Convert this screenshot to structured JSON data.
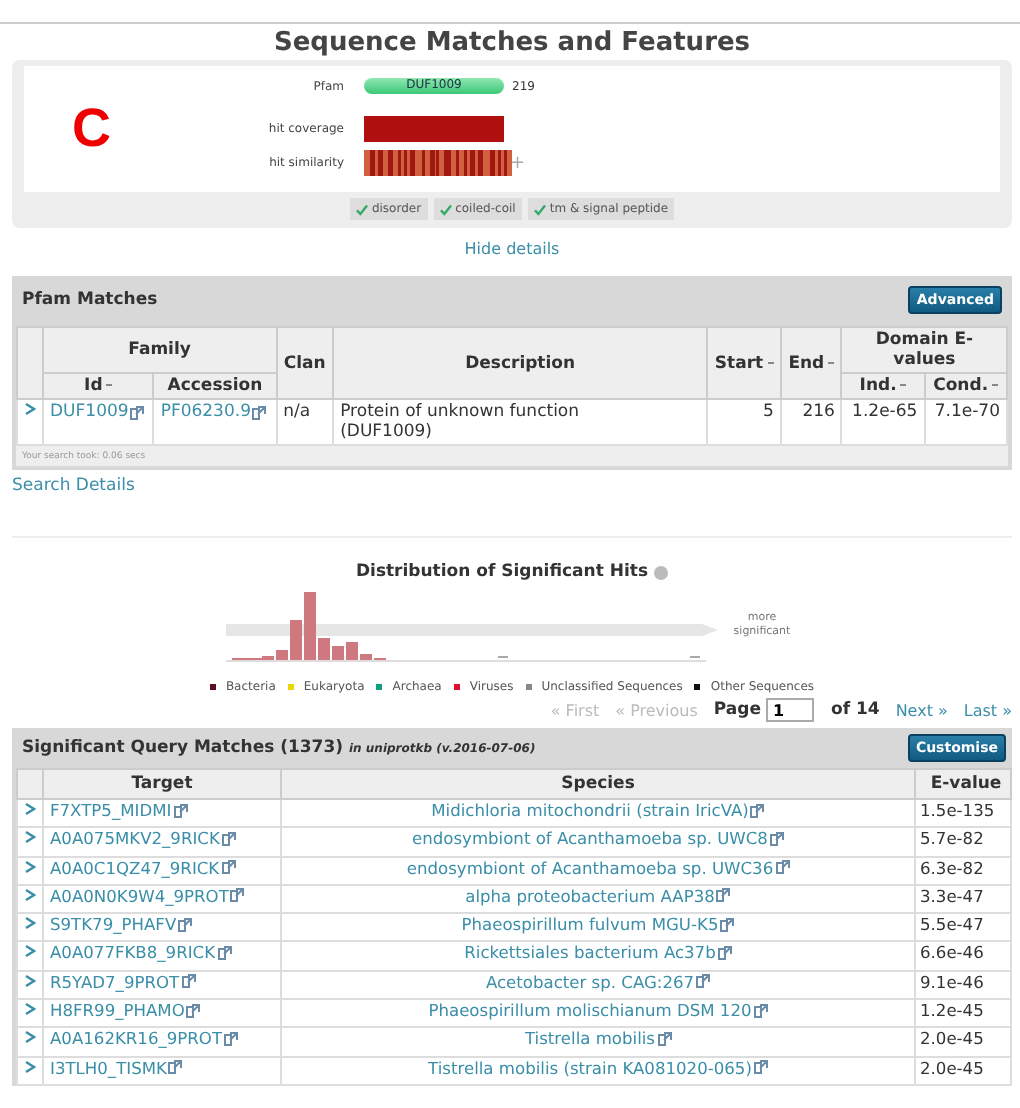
{
  "features": {
    "title": "Sequence Matches and Features",
    "panel_letter": "C",
    "pfam_label": "Pfam",
    "domain": "DUF1009",
    "length": "219",
    "coverage_label": "hit coverage",
    "similarity_label": "hit similarity",
    "expand": "+",
    "toggles": [
      {
        "label": "disorder",
        "checked": true
      },
      {
        "label": "coiled-coil",
        "checked": true
      },
      {
        "label": "tm & signal peptide",
        "checked": true
      }
    ],
    "hide_link": "Hide details"
  },
  "pfam_matches": {
    "title": "Pfam Matches",
    "button": "Advanced",
    "group_family": "Family",
    "group_evalues": "Domain E-values",
    "columns": [
      "Id",
      "Accession",
      "Clan",
      "Description",
      "Start",
      "End",
      "Ind.",
      "Cond."
    ],
    "rows": [
      {
        "id": "DUF1009",
        "accession": "PF06230.9",
        "clan": "n/a",
        "description": "Protein of unknown function (DUF1009)",
        "start": "5",
        "end": "216",
        "ind": "1.2e-65",
        "cond": "7.1e-70"
      }
    ],
    "footer": "Your search took: 0.06 secs",
    "search_details": "Search Details"
  },
  "distribution": {
    "title": "Distribution of Significant Hits",
    "arrow_label": "more significant",
    "legend": [
      {
        "label": "Bacteria",
        "color": "#5a1020"
      },
      {
        "label": "Eukaryota",
        "color": "#e8d800"
      },
      {
        "label": "Archaea",
        "color": "#10a080"
      },
      {
        "label": "Viruses",
        "color": "#e01030"
      },
      {
        "label": "Unclassified Sequences",
        "color": "#888888"
      },
      {
        "label": "Other Sequences",
        "color": "#111111"
      }
    ]
  },
  "pager": {
    "before": [
      {
        "label": "« First",
        "disabled": true
      },
      {
        "label": "« Previous",
        "disabled": true
      }
    ],
    "page_label": "Page",
    "page_value": "1",
    "total": "of 14",
    "after": [
      {
        "label": "Next »",
        "disabled": false
      },
      {
        "label": "Last »",
        "disabled": false
      }
    ]
  },
  "query_matches": {
    "title": "Significant Query Matches (1373)",
    "subtitle": "in uniprotkb (v.2016-07-06)",
    "button": "Customise",
    "columns": [
      "Target",
      "Species",
      "E-value"
    ],
    "rows": [
      {
        "target": "F7XTP5_MIDMI",
        "species": "Midichloria mitochondrii (strain IricVA)",
        "evalue": "1.5e-135"
      },
      {
        "target": "A0A075MKV2_9RICK",
        "species": "endosymbiont of Acanthamoeba sp. UWC8",
        "evalue": "5.7e-82"
      },
      {
        "target": "A0A0C1QZ47_9RICK",
        "species": "endosymbiont of Acanthamoeba sp. UWC36",
        "evalue": "6.3e-82"
      },
      {
        "target": "A0A0N0K9W4_9PROT",
        "species": "alpha proteobacterium AAP38",
        "evalue": "3.3e-47"
      },
      {
        "target": "S9TK79_PHAFV",
        "species": "Phaeospirillum fulvum MGU-K5",
        "evalue": "5.5e-47"
      },
      {
        "target": "A0A077FKB8_9RICK",
        "species": "Rickettsiales bacterium Ac37b",
        "evalue": "6.6e-46"
      },
      {
        "target": "R5YAD7_9PROT",
        "species": "Acetobacter sp. CAG:267",
        "evalue": "9.1e-46"
      },
      {
        "target": "H8FR99_PHAMO",
        "species": "Phaeospirillum molischianum DSM 120",
        "evalue": "1.2e-45"
      },
      {
        "target": "A0A162KR16_9PROT",
        "species": "Tistrella mobilis",
        "evalue": "2.0e-45"
      },
      {
        "target": "I3TLH0_TISMK",
        "species": "Tistrella mobilis (strain KA081020-065)",
        "evalue": "2.0e-45"
      }
    ]
  }
}
